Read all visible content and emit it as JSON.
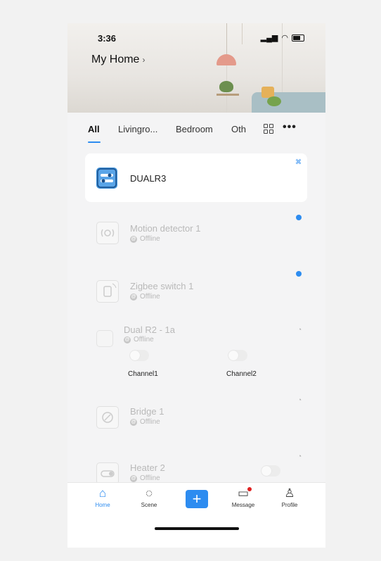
{
  "status_bar": {
    "time": "3:36"
  },
  "header": {
    "home_name": "My Home",
    "chevron": "›"
  },
  "tabs": [
    {
      "label": "All",
      "active": true
    },
    {
      "label": "Livingro...",
      "active": false
    },
    {
      "label": "Bedroom",
      "active": false
    },
    {
      "label": "Oth",
      "active": false
    }
  ],
  "more_glyph": "•••",
  "devices": {
    "dualr3": {
      "name": "DUALR3",
      "icon": "relay-icon"
    },
    "motion": {
      "name": "Motion detector 1",
      "status": "Offline",
      "icon": "motion-sensor-icon"
    },
    "zigbee": {
      "name": "Zigbee switch 1",
      "status": "Offline",
      "icon": "zigbee-switch-icon"
    },
    "dualr2": {
      "name": "Dual R2 - 1a",
      "status": "Offline",
      "channel1": "Channel1",
      "channel2": "Channel2",
      "icon": "relay-icon"
    },
    "bridge": {
      "name": "Bridge 1",
      "status": "Offline",
      "icon": "bridge-icon"
    },
    "heater": {
      "name": "Heater 2",
      "status": "Offline",
      "icon": "heater-icon"
    }
  },
  "bottom_nav": {
    "home": "Home",
    "scene": "Scene",
    "add": "+",
    "message": "Message",
    "profile": "Profile"
  },
  "colors": {
    "accent": "#2d8cf0",
    "alert": "#e02020"
  }
}
